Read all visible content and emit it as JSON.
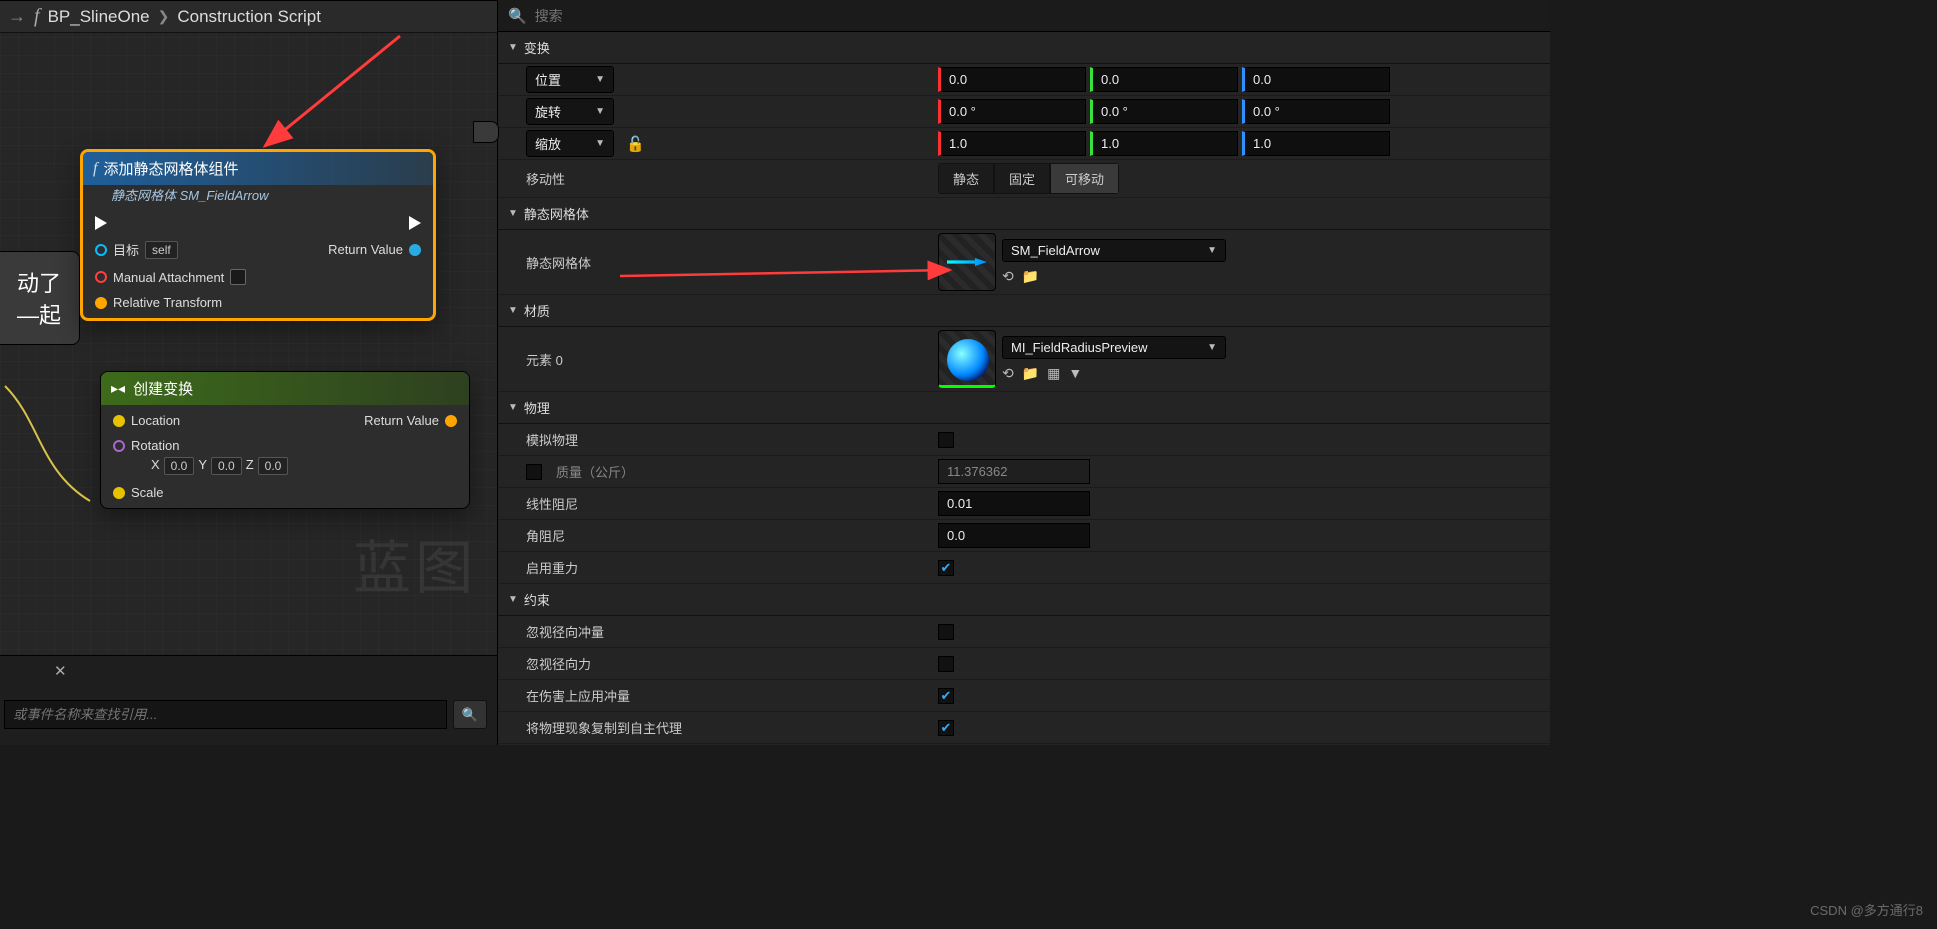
{
  "breadcrumb": {
    "item1": "BP_SlineOne",
    "item2": "Construction Script"
  },
  "graph": {
    "watermark": "蓝图",
    "edgeNode1": {
      "line1": "动了",
      "line2": "—起"
    },
    "node1": {
      "title": "添加静态网格体组件",
      "subtitle": "静态网格体 SM_FieldArrow",
      "target_lbl": "目标",
      "target_val": "self",
      "manual_lbl": "Manual Attachment",
      "reltrans_lbl": "Relative Transform",
      "return_lbl": "Return Value"
    },
    "node2": {
      "title": "创建变换",
      "loc": "Location",
      "rot": "Rotation",
      "scale": "Scale",
      "return": "Return Value",
      "rx": "0.0",
      "ry": "0.0",
      "rz": "0.0",
      "X": "X",
      "Y": "Y",
      "Z": "Z"
    },
    "find_placeholder": "或事件名称来查找引用..."
  },
  "search": {
    "placeholder": "搜索"
  },
  "sections": {
    "transform": "变换",
    "static_mesh_hdr": "静态网格体",
    "material": "材质",
    "physics": "物理",
    "constraint": "约束"
  },
  "transform": {
    "pos_lbl": "位置",
    "rot_lbl": "旋转",
    "scale_lbl": "缩放",
    "mob_lbl": "移动性",
    "pos": {
      "x": "0.0",
      "y": "0.0",
      "z": "0.0"
    },
    "rot": {
      "x": "0.0 °",
      "y": "0.0 °",
      "z": "0.0 °"
    },
    "scale": {
      "x": "1.0",
      "y": "1.0",
      "z": "1.0"
    },
    "mob": {
      "static": "静态",
      "fixed": "固定",
      "movable": "可移动"
    }
  },
  "static_mesh": {
    "label": "静态网格体",
    "asset": "SM_FieldArrow"
  },
  "material": {
    "label": "元素 0",
    "asset": "MI_FieldRadiusPreview"
  },
  "physics": {
    "simulate": "模拟物理",
    "mass": "质量（公斤）",
    "mass_val": "11.376362",
    "linear_damp": "线性阻尼",
    "linear_damp_val": "0.01",
    "ang_damp": "角阻尼",
    "ang_damp_val": "0.0",
    "gravity": "启用重力"
  },
  "constraint": {
    "ignore_radial_impulse": "忽视径向冲量",
    "ignore_radial_force": "忽视径向力",
    "apply_damage_impulse": "在伤害上应用冲量",
    "replicate_proxy": "将物理现象复制到自主代理"
  },
  "footer": "CSDN @多方通行8"
}
